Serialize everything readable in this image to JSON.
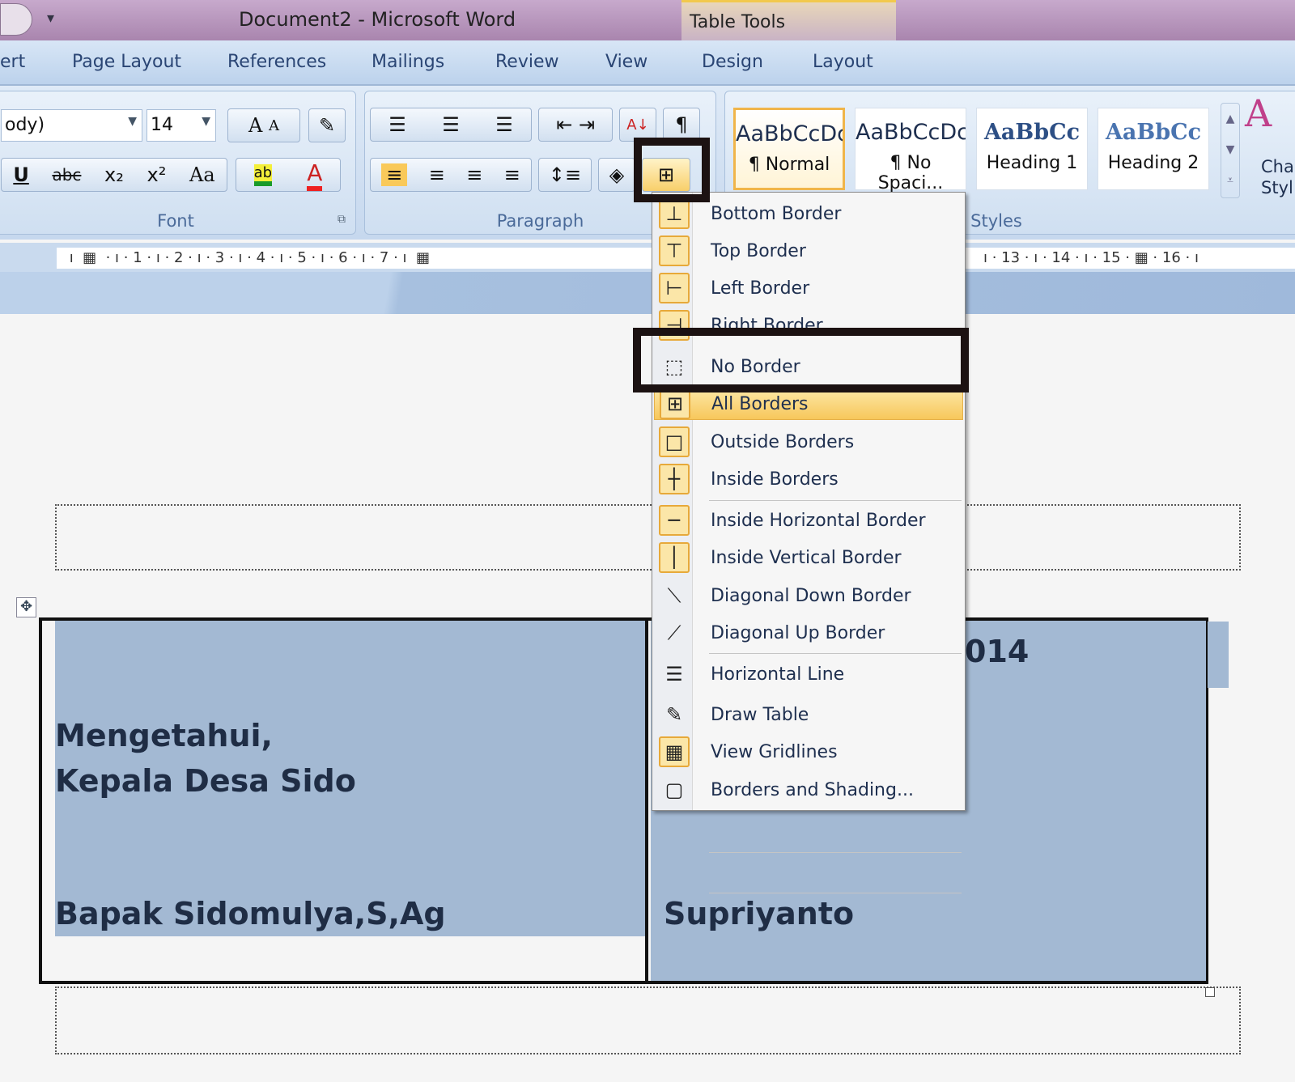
{
  "window": {
    "title": "Document2 - Microsoft Word",
    "context_tab": "Table Tools"
  },
  "tabs": [
    "ert",
    "Page Layout",
    "References",
    "Mailings",
    "Review",
    "View",
    "Design",
    "Layout"
  ],
  "font_group": {
    "label": "Font",
    "font_name": "ody)",
    "font_size": "14",
    "buttons": [
      "A",
      "A",
      "U",
      "abc",
      "x₂",
      "x²",
      "Aa",
      "ab",
      "A"
    ]
  },
  "paragraph_group": {
    "label": "Paragraph"
  },
  "styles_group": {
    "label": "Styles",
    "styles": [
      {
        "preview": "AaBbCcDc",
        "name": "¶ Normal"
      },
      {
        "preview": "AaBbCcDc",
        "name": "¶ No Spaci..."
      },
      {
        "preview": "AaBbCc",
        "name": "Heading 1"
      },
      {
        "preview": "AaBbCc",
        "name": "Heading 2"
      }
    ],
    "change_styles": "Change Styles",
    "change_styles_l1": "Cha",
    "change_styles_l2": "Styl"
  },
  "ruler": " ı  ▦  · ı · 1 · ı · 2 · ı · 3 · ı · 4 · ı · 5 · ı · 6 · ı · 7 · ı  ▦",
  "ruler_right": "ı · 13 · ı · 14 · ı · 15 · ▦ · 16 · ı",
  "border_menu": {
    "items": [
      {
        "label": "Bottom Border",
        "icon": "bottom-border-icon"
      },
      {
        "label": "Top Border",
        "icon": "top-border-icon"
      },
      {
        "label": "Left Border",
        "icon": "left-border-icon"
      },
      {
        "label": "Right Border",
        "icon": "right-border-icon"
      },
      {
        "label": "No Border",
        "icon": "no-border-icon"
      },
      {
        "label": "All Borders",
        "icon": "all-borders-icon",
        "highlighted": true
      },
      {
        "label": "Outside Borders",
        "icon": "outside-borders-icon"
      },
      {
        "label": "Inside Borders",
        "icon": "inside-borders-icon"
      },
      {
        "label": "Inside Horizontal Border",
        "icon": "inside-horizontal-border-icon"
      },
      {
        "label": "Inside Vertical Border",
        "icon": "inside-vertical-border-icon"
      },
      {
        "label": "Diagonal Down Border",
        "icon": "diagonal-down-border-icon"
      },
      {
        "label": "Diagonal Up Border",
        "icon": "diagonal-up-border-icon"
      },
      {
        "label": "Horizontal Line",
        "icon": "horizontal-line-icon"
      },
      {
        "label": "Draw Table",
        "icon": "draw-table-icon"
      },
      {
        "label": "View Gridlines",
        "icon": "view-gridlines-icon"
      },
      {
        "label": "Borders and Shading...",
        "icon": "borders-shading-icon"
      }
    ]
  },
  "document": {
    "left_cell": {
      "line1": "Mengetahui,",
      "line2": "Kepala Desa Sido",
      "name": "Bapak Sidomulya,S,Ag"
    },
    "right_cell": {
      "year_fragment": "014",
      "name": "Supriyanto"
    }
  },
  "colors": {
    "cell_shading": "#a3b9d3",
    "highlight_box": "#1c1212",
    "menu_highlight": "#f7c75b"
  }
}
